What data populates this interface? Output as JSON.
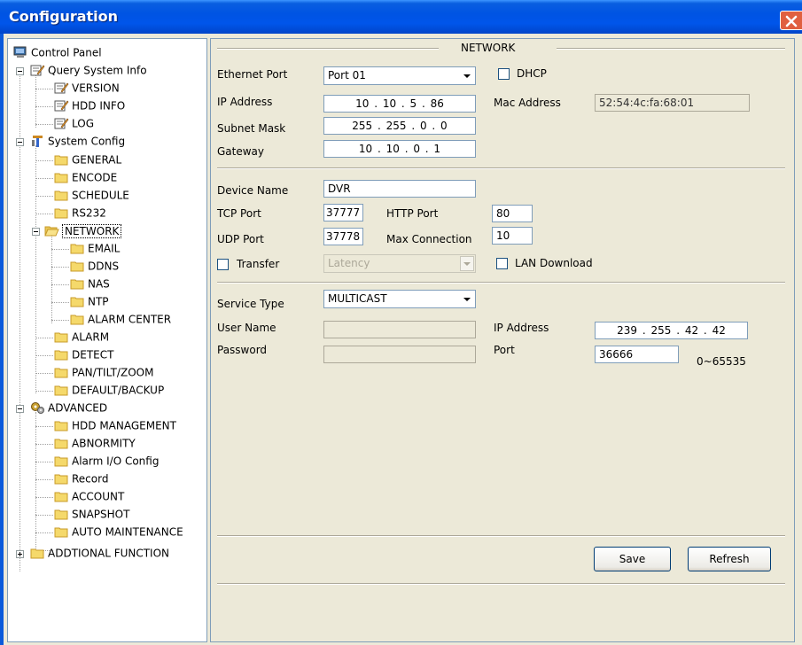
{
  "window": {
    "title": "Configuration"
  },
  "tree": {
    "control_panel": "Control Panel",
    "query_system_info": "Query System Info",
    "version": "VERSION",
    "hdd_info": "HDD INFO",
    "log": "LOG",
    "system_config": "System Config",
    "general": "GENERAL",
    "encode": "ENCODE",
    "schedule": "SCHEDULE",
    "rs232": "RS232",
    "network": "NETWORK",
    "email": "EMAIL",
    "ddns": "DDNS",
    "nas": "NAS",
    "ntp": "NTP",
    "alarm_center": "ALARM CENTER",
    "alarm": "ALARM",
    "detect": "DETECT",
    "ptz": "PAN/TILT/ZOOM",
    "default_backup": "DEFAULT/BACKUP",
    "advanced": "ADVANCED",
    "hdd_management": "HDD MANAGEMENT",
    "abnormity": "ABNORMITY",
    "alarm_io": "Alarm I/O Config",
    "record": "Record",
    "account": "ACCOUNT",
    "snapshot": "SNAPSHOT",
    "auto_maintenance": "AUTO MAINTENANCE",
    "additional_function": "ADDTIONAL FUNCTION"
  },
  "network": {
    "section_title": "NETWORK",
    "ethernet_port_label": "Ethernet Port",
    "ethernet_port_value": "Port 01",
    "dhcp_label": "DHCP",
    "dhcp_checked": false,
    "ip_label": "IP Address",
    "ip_value": "10 .  10 .  5  .  86",
    "mac_label": "Mac Address",
    "mac_value": "52:54:4c:fa:68:01",
    "subnet_label": "Subnet Mask",
    "subnet_value": "255 . 255 .  0  .  0",
    "gateway_label": "Gateway",
    "gateway_value": "10 .  10 .  0  .  1",
    "device_name_label": "Device Name",
    "device_name_value": "DVR",
    "tcp_label": "TCP Port",
    "tcp_value": "37777",
    "http_label": "HTTP Port",
    "http_value": "80",
    "udp_label": "UDP Port",
    "udp_value": "37778",
    "maxconn_label": "Max Connection",
    "maxconn_value": "10",
    "transfer_label": "Transfer",
    "transfer_mode": "Latency",
    "lan_download_label": "LAN Download",
    "service_type_label": "Service Type",
    "service_type_value": "MULTICAST",
    "user_name_label": "User Name",
    "password_label": "Password",
    "svc_ip_label": "IP Address",
    "svc_ip_value": "239  .  255  .  42  .  42",
    "port_label": "Port",
    "port_value": "36666",
    "port_range": "0~65535"
  },
  "buttons": {
    "save": "Save",
    "refresh": "Refresh"
  },
  "colors": {
    "title_bar": "#0054e3",
    "window_bg": "#ece9d8",
    "folder": "#f5d96b"
  }
}
